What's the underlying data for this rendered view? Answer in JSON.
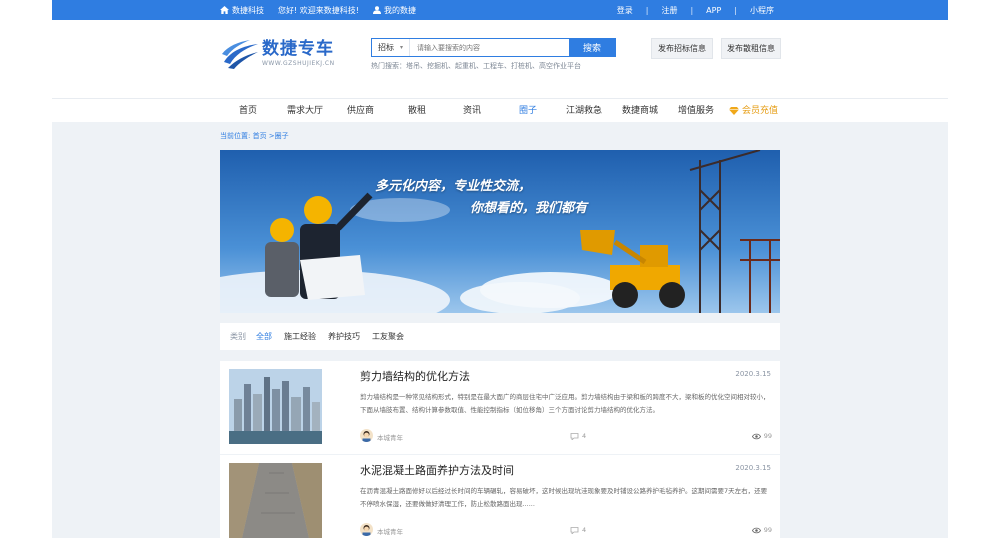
{
  "topbar": {
    "brand": "数捷科技",
    "welcome": "您好! 欢迎来数捷科技!",
    "my": "我的数捷",
    "links": [
      "登录",
      "注册",
      "APP",
      "小程序"
    ],
    "separator": "|"
  },
  "logo": {
    "title": "数捷专车",
    "sub": "WWW.GZSHUJIEKJ.CN"
  },
  "search": {
    "type": "招标",
    "placeholder": "请输入要搜索的内容",
    "button": "搜索",
    "hot": "热门搜索：塔吊、挖掘机、起重机、工程车、打桩机、高空作业平台"
  },
  "header_buttons": {
    "bid": "发布招标信息",
    "rent": "发布散租信息"
  },
  "nav": [
    "首页",
    "需求大厅",
    "供应商",
    "散租",
    "资讯",
    "圈子",
    "江湖救急",
    "数捷商城",
    "增值服务"
  ],
  "nav_active": "圈子",
  "vip": "会员充值",
  "breadcrumb": "当前位置: 首页 >圈子",
  "banner": {
    "line1": "多元化内容，专业性交流，",
    "line2": "你想看的，我们都有"
  },
  "categories": {
    "label": "类别",
    "items": [
      "全部",
      "施工经验",
      "养护技巧",
      "工友聚会"
    ],
    "active": "全部"
  },
  "articles": [
    {
      "title": "剪力墙结构的优化方法",
      "date": "2020.3.15",
      "desc": "剪力墙结构是一种常见结构形式，特别是在最大面广的商层住宅中广泛应用。剪力墙结构由于梁和板的跨度不大，梁和板的优化空间相对较小，下面从墙肢布置、结构计算参数取值、性能控制指标（如位移角）三个方面讨论剪力墙结构的优化方法。",
      "author": "本城青年",
      "comments": "4",
      "views": "99"
    },
    {
      "title": "水泥混凝土路面养护方法及时间",
      "date": "2020.3.15",
      "desc": "在沥青混凝土路面修好以后经过长时间的车辆碾轧，容易破坏，这时候出现坑洼现象要及时铺设公路养护毛毡养护。这期间需要7天左右，还要不停喷水保湿，还要做做好清理工作，防止松散路面出现......",
      "author": "本城青年",
      "comments": "4",
      "views": "99"
    }
  ],
  "colors": {
    "primary": "#2f7de1",
    "vip": "#e69c12",
    "background": "#eef2f6"
  },
  "icons": [
    "home-icon",
    "user-icon",
    "chevron-down-icon",
    "diamond-icon",
    "comment-icon",
    "eye-icon"
  ]
}
